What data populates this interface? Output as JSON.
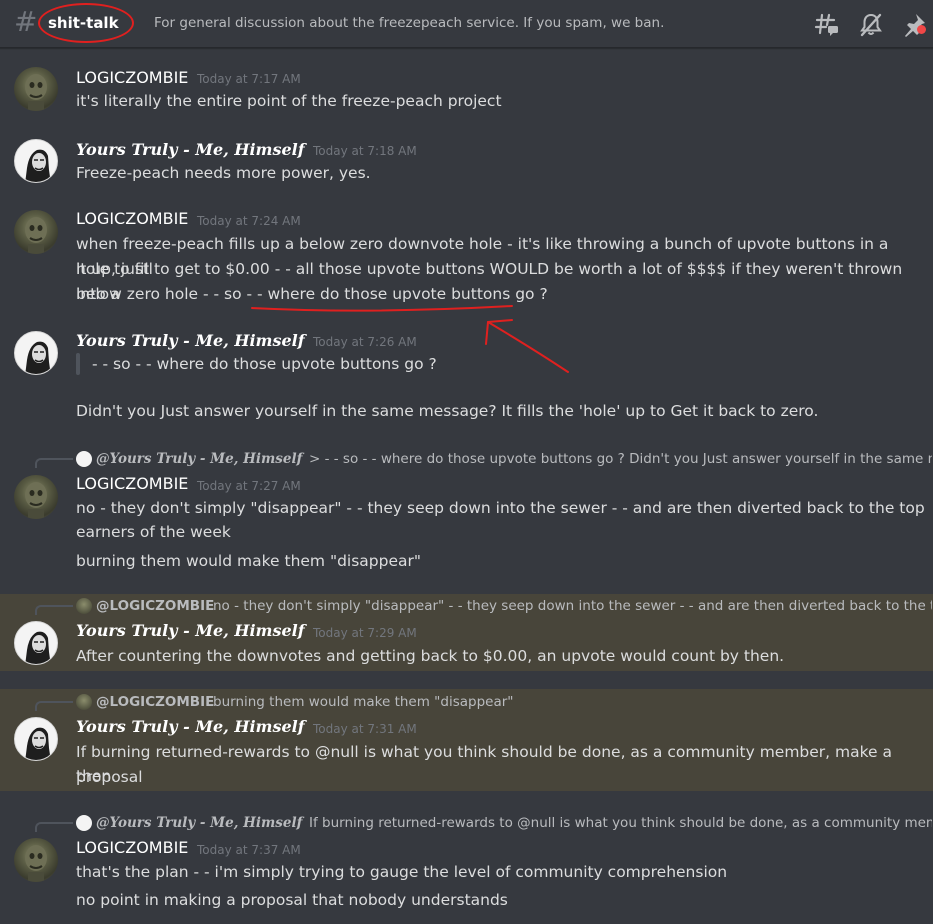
{
  "header": {
    "hash": "#",
    "channel_name": "shit-talk",
    "topic": "For general discussion about the freezepeach service. If you spam, we ban."
  },
  "messages": [
    {
      "username": "LOGICZOMBIE",
      "timestamp": "Today at 7:17 AM",
      "lines": [
        "it's literally the entire point of the freeze-peach project"
      ]
    },
    {
      "username": "Yours Truly - Me, Himself",
      "timestamp": "Today at 7:18 AM",
      "lines": [
        "Freeze-peach needs more power, yes."
      ]
    },
    {
      "username": "LOGICZOMBIE",
      "timestamp": "Today at 7:24 AM",
      "lines": [
        "when freeze-peach fills up a below zero downvote hole - it's like throwing a bunch of upvote buttons in a hole to fill",
        "it up, just to get to $0.00 - - all those upvote buttons WOULD be worth a lot of $$$$ if they weren't thrown into a",
        "below zero hole - - so - - where do those upvote buttons go ?"
      ]
    },
    {
      "username": "Yours Truly - Me, Himself",
      "timestamp": "Today at 7:26 AM",
      "quote": "- - so - - where do those upvote buttons go ?",
      "lines": [
        "Didn't you Just answer yourself in the same message? It fills the 'hole' up to Get it back to zero."
      ]
    },
    {
      "username": "LOGICZOMBIE",
      "timestamp": "Today at 7:27 AM",
      "reply": {
        "name": "@Yours Truly - Me, Himself",
        "text": "> - - so - - where do those upvote buttons go ?  Didn't you Just answer yourself in the same m..."
      },
      "lines": [
        "no - they don't simply \"disappear\" - - they seep down into the sewer - - and are then diverted back to the top",
        "earners of the week",
        "burning them would make them \"disappear\""
      ]
    },
    {
      "username": "Yours Truly - Me, Himself",
      "timestamp": "Today at 7:29 AM",
      "reply": {
        "name": "@LOGICZOMBIE",
        "text": "no - they don't simply \"disappear\" - - they seep down into the sewer - - and are then diverted back to the top ..."
      },
      "lines": [
        "After countering the downvotes and getting back to $0.00, an upvote would count by then."
      ]
    },
    {
      "username": "Yours Truly - Me, Himself",
      "timestamp": "Today at 7:31 AM",
      "reply": {
        "name": "@LOGICZOMBIE",
        "text": "burning them would make them \"disappear\""
      },
      "lines": [
        "If burning returned-rewards to @null is what you think should be done, as a community member, make a proposal",
        "then."
      ]
    },
    {
      "username": "LOGICZOMBIE",
      "timestamp": "Today at 7:37 AM",
      "reply": {
        "name": "@Yours Truly - Me, Himself",
        "text": "If burning returned-rewards to @null is what you think should be done, as a community memb..."
      },
      "lines": [
        "that's the plan - - i'm simply trying to gauge the level of community comprehension",
        "no point in making a proposal that nobody understands"
      ]
    }
  ],
  "colors": {
    "background": "#36393f",
    "highlight": "#48453a",
    "annotation_red": "#e0201f",
    "username": "#ffffff",
    "timestamp": "#72767d",
    "text": "#dcddde"
  },
  "icons": [
    "threads-icon",
    "mute-icon",
    "pin-icon"
  ]
}
